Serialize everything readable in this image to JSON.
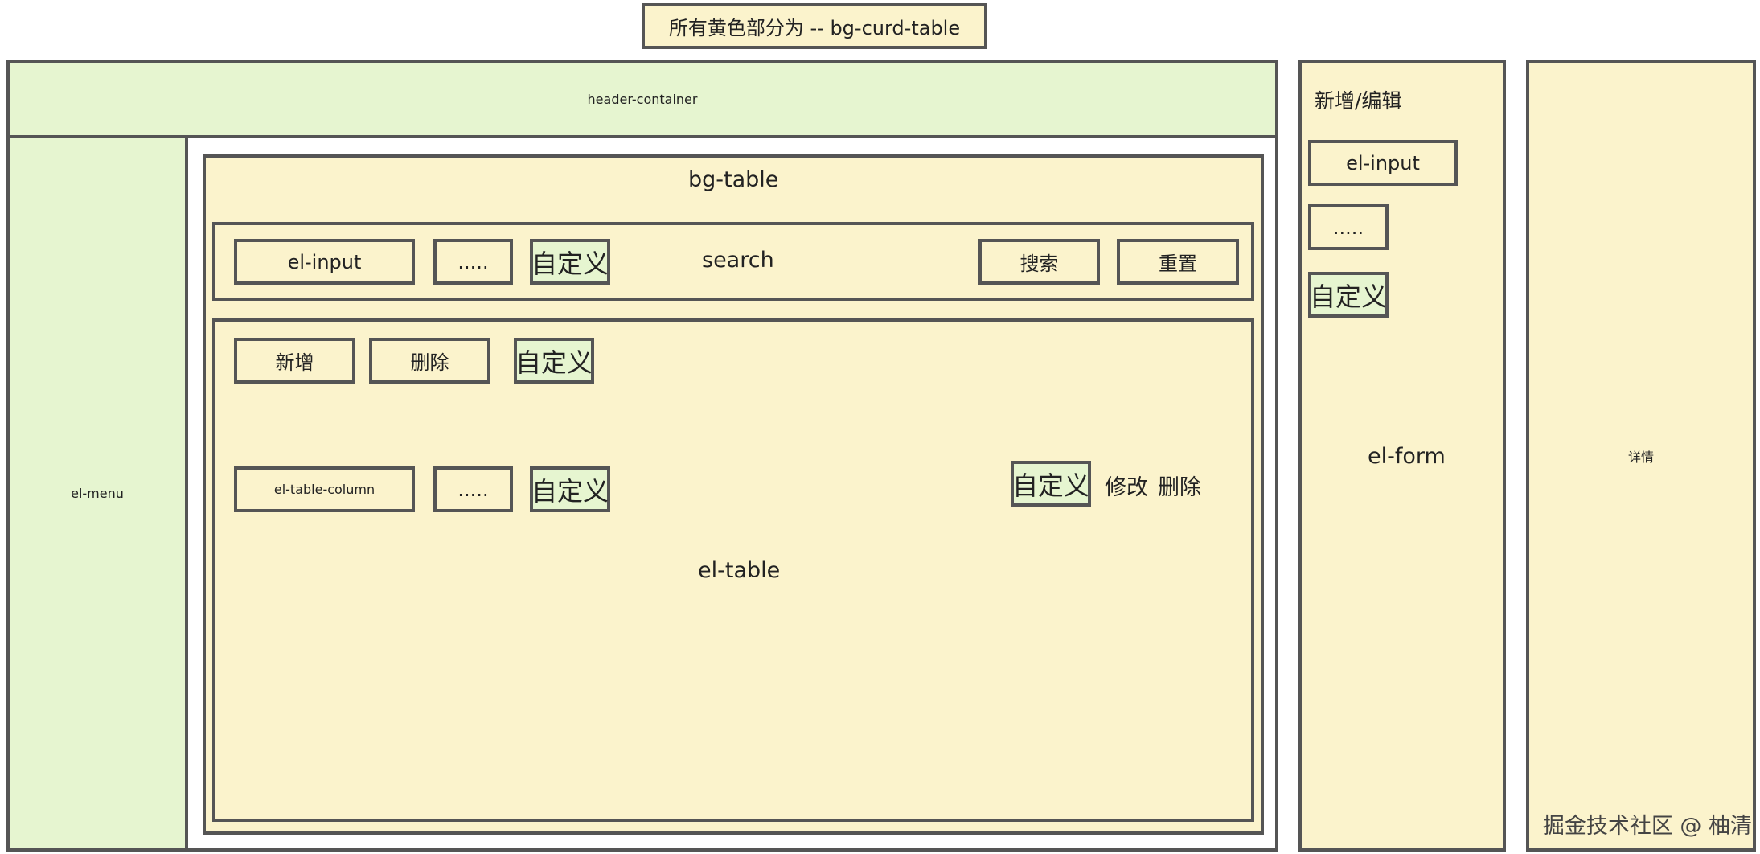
{
  "title": "所有黄色部分为 -- bg-curd-table",
  "header": "header-container",
  "menu": "el-menu",
  "bg_table": {
    "label": "bg-table",
    "search": {
      "label": "search",
      "input": "el-input",
      "more": ".....",
      "custom": "自定义",
      "search_button": "搜索",
      "reset_button": "重置"
    },
    "table": {
      "label": "el-table",
      "toolbar": {
        "add": "新增",
        "delete": "删除",
        "custom": "自定义"
      },
      "column": "el-table-column",
      "more": ".....",
      "custom": "自定义",
      "row_actions": {
        "custom": "自定义",
        "edit": "修改",
        "delete": "删除"
      }
    }
  },
  "form_panel": {
    "title": "新增/编辑",
    "input": "el-input",
    "more": ".....",
    "custom": "自定义",
    "label": "el-form"
  },
  "detail_panel": {
    "label": "详情"
  },
  "watermark": "掘金技术社区 @ 柚清"
}
